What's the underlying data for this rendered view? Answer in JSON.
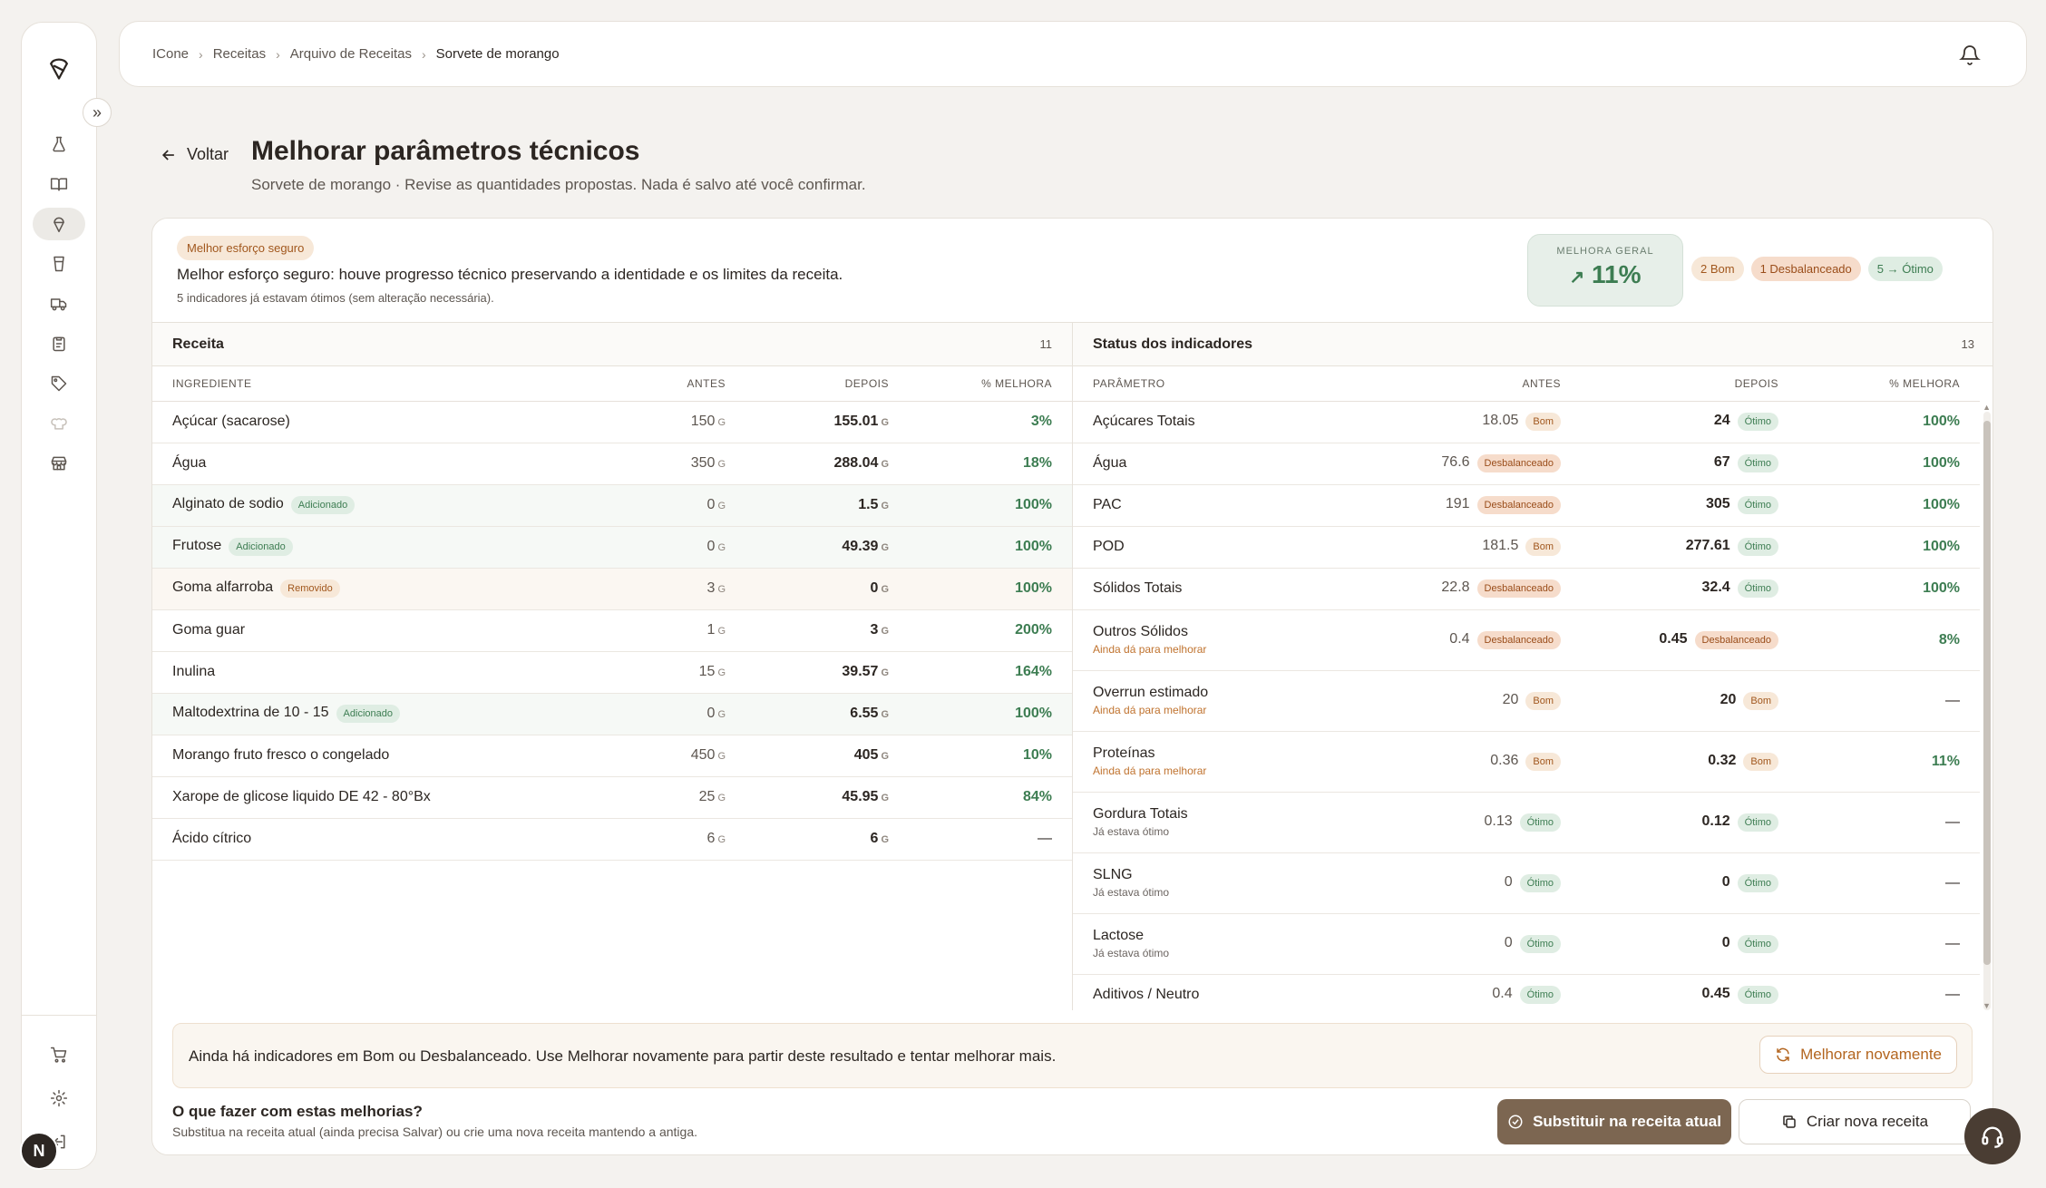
{
  "breadcrumb": [
    "ICone",
    "Receitas",
    "Arquivo de Receitas",
    "Sorvete de morango"
  ],
  "back_label": "Voltar",
  "page_title": "Melhorar parâmetros técnicos",
  "page_subtitle": "Sorvete de morango · Revise as quantidades propostas. Nada é salvo até você confirmar.",
  "summary": {
    "badge": "Melhor esforço seguro",
    "line": "Melhor esforço seguro: houve progresso técnico preservando a identidade e os limites da receita.",
    "small": "5 indicadores já estavam ótimos (sem alteração necessária).",
    "overall_label": "MELHORA GERAL",
    "overall_value": "11%",
    "counts": [
      "2 Bom",
      "1 Desbalanceado",
      "5 → Ótimo"
    ]
  },
  "recipe": {
    "title": "Receita",
    "count": "11",
    "columns": [
      "INGREDIENTE",
      "ANTES",
      "DEPOIS",
      "% MELHORA"
    ],
    "rows": [
      {
        "name": "Açúcar (sacarose)",
        "tag": "",
        "before": "150",
        "after": "155.01",
        "pct": "3%"
      },
      {
        "name": "Água",
        "tag": "",
        "before": "350",
        "after": "288.04",
        "pct": "18%"
      },
      {
        "name": "Alginato de sodio",
        "tag": "Adicionado",
        "before": "0",
        "after": "1.5",
        "pct": "100%"
      },
      {
        "name": "Frutose",
        "tag": "Adicionado",
        "before": "0",
        "after": "49.39",
        "pct": "100%"
      },
      {
        "name": "Goma alfarroba",
        "tag": "Removido",
        "before": "3",
        "after": "0",
        "pct": "100%"
      },
      {
        "name": "Goma guar",
        "tag": "",
        "before": "1",
        "after": "3",
        "pct": "200%"
      },
      {
        "name": "Inulina",
        "tag": "",
        "before": "15",
        "after": "39.57",
        "pct": "164%"
      },
      {
        "name": "Maltodextrina de 10 - 15",
        "tag": "Adicionado",
        "before": "0",
        "after": "6.55",
        "pct": "100%"
      },
      {
        "name": "Morango fruto fresco o congelado",
        "tag": "",
        "before": "450",
        "after": "405",
        "pct": "10%"
      },
      {
        "name": "Xarope de glicose liquido DE 42 - 80°Bx",
        "tag": "",
        "before": "25",
        "after": "45.95",
        "pct": "84%"
      },
      {
        "name": "Ácido cítrico",
        "tag": "",
        "before": "6",
        "after": "6",
        "pct": "—"
      }
    ],
    "unit": "G"
  },
  "indicators": {
    "title": "Status dos indicadores",
    "count": "13",
    "columns": [
      "PARÂMETRO",
      "ANTES",
      "DEPOIS",
      "% MELHORA"
    ],
    "rows": [
      {
        "name": "Açúcares Totais",
        "note": "",
        "before": "18.05",
        "before_status": "Bom",
        "after": "24",
        "after_status": "Ótimo",
        "pct": "100%"
      },
      {
        "name": "Água",
        "note": "",
        "before": "76.6",
        "before_status": "Desbalanceado",
        "after": "67",
        "after_status": "Ótimo",
        "pct": "100%"
      },
      {
        "name": "PAC",
        "note": "",
        "before": "191",
        "before_status": "Desbalanceado",
        "after": "305",
        "after_status": "Ótimo",
        "pct": "100%"
      },
      {
        "name": "POD",
        "note": "",
        "before": "181.5",
        "before_status": "Bom",
        "after": "277.61",
        "after_status": "Ótimo",
        "pct": "100%"
      },
      {
        "name": "Sólidos Totais",
        "note": "",
        "before": "22.8",
        "before_status": "Desbalanceado",
        "after": "32.4",
        "after_status": "Ótimo",
        "pct": "100%"
      },
      {
        "name": "Outros Sólidos",
        "note": "Ainda dá para melhorar",
        "before": "0.4",
        "before_status": "Desbalanceado",
        "after": "0.45",
        "after_status": "Desbalanceado",
        "pct": "8%"
      },
      {
        "name": "Overrun estimado",
        "note": "Ainda dá para melhorar",
        "before": "20",
        "before_status": "Bom",
        "after": "20",
        "after_status": "Bom",
        "pct": "—"
      },
      {
        "name": "Proteínas",
        "note": "Ainda dá para melhorar",
        "before": "0.36",
        "before_status": "Bom",
        "after": "0.32",
        "after_status": "Bom",
        "pct": "11%"
      },
      {
        "name": "Gordura Totais",
        "note": "Já estava ótimo",
        "before": "0.13",
        "before_status": "Ótimo",
        "after": "0.12",
        "after_status": "Ótimo",
        "pct": "—"
      },
      {
        "name": "SLNG",
        "note": "Já estava ótimo",
        "before": "0",
        "before_status": "Ótimo",
        "after": "0",
        "after_status": "Ótimo",
        "pct": "—"
      },
      {
        "name": "Lactose",
        "note": "Já estava ótimo",
        "before": "0",
        "before_status": "Ótimo",
        "after": "0",
        "after_status": "Ótimo",
        "pct": "—"
      },
      {
        "name": "Aditivos / Neutro",
        "note": "",
        "before": "0.4",
        "before_status": "Ótimo",
        "after": "0.45",
        "after_status": "Ótimo",
        "pct": "—"
      }
    ]
  },
  "footer": {
    "note": "Ainda há indicadores em Bom ou Desbalanceado. Use Melhorar novamente para partir deste resultado e tentar melhorar mais.",
    "retry_label": "Melhorar novamente",
    "question": "O que fazer com estas melhorias?",
    "question_sub": "Substitua na receita atual (ainda precisa Salvar) ou crie uma nova receita mantendo a antiga.",
    "replace_label": "Substituir na receita atual",
    "new_label": "Criar nova receita"
  },
  "avatar_initial": "N",
  "colors": {
    "accent_dark": "#7c6651",
    "good": "#3d7d52",
    "warn": "#b3651f"
  }
}
